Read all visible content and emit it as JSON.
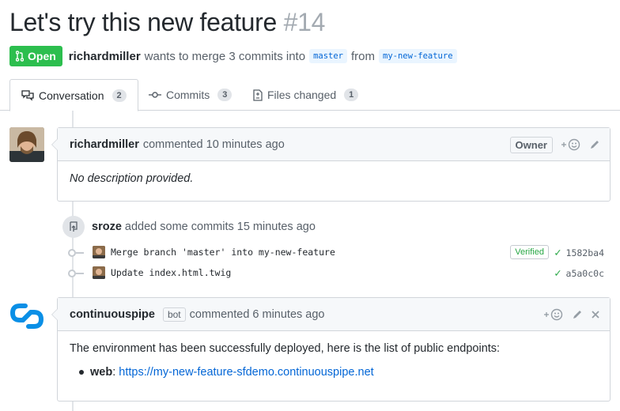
{
  "pr": {
    "title": "Let's try this new feature",
    "number": "#14",
    "state": "Open",
    "author": "richardmiller",
    "merge_text": "wants to merge 3 commits into",
    "base_branch": "master",
    "from_text": "from",
    "head_branch": "my-new-feature"
  },
  "tabs": [
    {
      "label": "Conversation",
      "count": "2",
      "icon": "comment-discussion-icon"
    },
    {
      "label": "Commits",
      "count": "3",
      "icon": "git-commit-icon"
    },
    {
      "label": "Files changed",
      "count": "1",
      "icon": "file-diff-icon"
    }
  ],
  "comment1": {
    "author": "richardmiller",
    "action": "commented 10 minutes ago",
    "badge": "Owner",
    "body": "No description provided."
  },
  "commits_event": {
    "author": "sroze",
    "action": "added some commits 15 minutes ago",
    "commits": [
      {
        "message": "Merge branch 'master' into my-new-feature",
        "verified": "Verified",
        "sha": "1582ba4"
      },
      {
        "message": "Update index.html.twig",
        "sha": "a5a0c0c"
      }
    ]
  },
  "comment2": {
    "author": "continuouspipe",
    "bot_label": "bot",
    "action": "commented 6 minutes ago",
    "body": "The environment has been successfully deployed, here is the list of public endpoints:",
    "endpoint_name": "web",
    "endpoint_url": "https://my-new-feature-sfdemo.continuouspipe.net"
  },
  "colors": {
    "open_green": "#2cbe4e",
    "link_blue": "#0366d6",
    "cp_blue": "#0a8fe6"
  }
}
